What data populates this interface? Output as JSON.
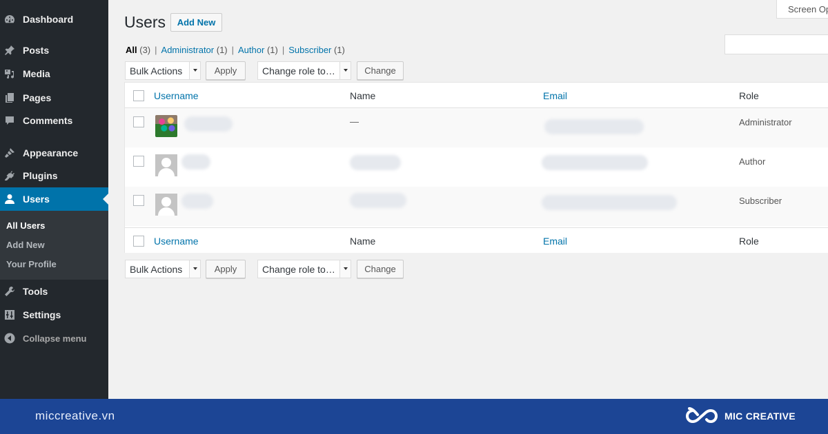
{
  "sidebar": {
    "items": [
      {
        "label": "Dashboard",
        "icon": "dashboard-icon"
      },
      {
        "label": "Posts",
        "icon": "pin-icon"
      },
      {
        "label": "Media",
        "icon": "media-icon"
      },
      {
        "label": "Pages",
        "icon": "pages-icon"
      },
      {
        "label": "Comments",
        "icon": "comment-icon"
      },
      {
        "label": "Appearance",
        "icon": "brush-icon"
      },
      {
        "label": "Plugins",
        "icon": "plugin-icon"
      },
      {
        "label": "Users",
        "icon": "user-icon",
        "active": true
      },
      {
        "label": "Tools",
        "icon": "wrench-icon"
      },
      {
        "label": "Settings",
        "icon": "settings-icon"
      },
      {
        "label": "Collapse menu",
        "icon": "collapse-icon"
      }
    ],
    "submenu": [
      {
        "label": "All Users",
        "current": true
      },
      {
        "label": "Add New"
      },
      {
        "label": "Your Profile"
      }
    ]
  },
  "header": {
    "title": "Users",
    "add_new_label": "Add New",
    "screen_options_label": "Screen Op",
    "search_value": ""
  },
  "filters": [
    {
      "label": "All",
      "count": "(3)",
      "current": true
    },
    {
      "label": "Administrator",
      "count": "(1)"
    },
    {
      "label": "Author",
      "count": "(1)"
    },
    {
      "label": "Subscriber",
      "count": "(1)"
    }
  ],
  "actions": {
    "bulk_actions": "Bulk Actions",
    "apply": "Apply",
    "change_role": "Change role to…",
    "change": "Change"
  },
  "table": {
    "columns": [
      "Username",
      "Name",
      "Email",
      "Role"
    ],
    "rows": [
      {
        "username": "",
        "name": "—",
        "email": "",
        "role": "Administrator",
        "avatar": "custom"
      },
      {
        "username": "",
        "name": "",
        "email": "",
        "role": "Author",
        "avatar": "default"
      },
      {
        "username": "",
        "name": "",
        "email": "",
        "role": "Subscriber",
        "avatar": "default"
      }
    ]
  },
  "brand": {
    "url": "miccreative.vn",
    "name": "MIC CREATIVE",
    "color": "#1c4595"
  }
}
